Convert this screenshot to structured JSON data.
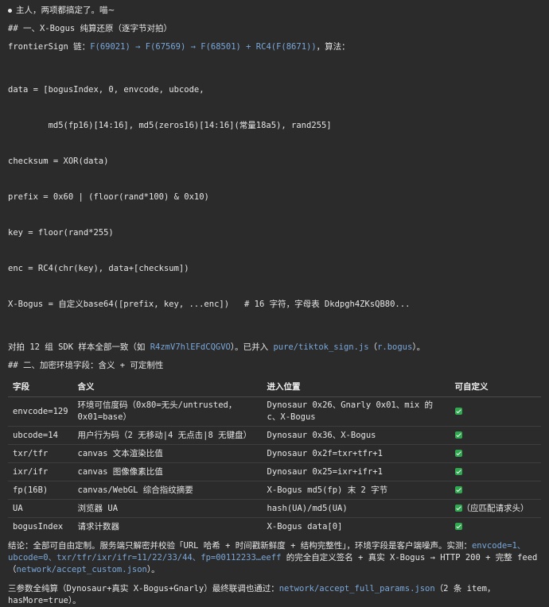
{
  "intro": "主人，两项都搞定了。喵~",
  "section1": {
    "heading": "## 一、X-Bogus 纯算还原（逐字节对拍）",
    "chain_prefix": "frontierSign 链：",
    "chain": "F(69021) → F(67569) → F(68501) + RC4(F(8671))",
    "chain_suffix": "，算法：",
    "code_lines": [
      "data = [bogusIndex, 0, envcode, ubcode,",
      "        md5(fp16)[14:16], md5(zeros16)[14:16](常量18a5), rand255]",
      "checksum = XOR(data)",
      "prefix = 0x60 | (floor(rand*100) & 0x10)",
      "key = floor(rand*255)",
      "enc = RC4(chr(key), data+[checksum])",
      "X-Bogus = 自定义base64([prefix, key, ...enc])   # 16 字符，字母表 Dkdpgh4ZKsQB80..."
    ],
    "verify_a": "对拍 12 组 SDK 样本全部一致（如 ",
    "verify_sample": "R4zmV7hlEFdCQGVO",
    "verify_b": "）。已并入 ",
    "verify_file": "pure/tiktok_sign.js",
    "verify_c": "（",
    "verify_fn": "r.bogus",
    "verify_d": "）。"
  },
  "section2": {
    "heading": "## 二、加密环境字段：含义 + 可定制性",
    "headers": [
      "字段",
      "含义",
      "进入位置",
      "可自定义"
    ],
    "rows": [
      {
        "field": "envcode=129",
        "meaning": "环境可信度码（0x80=无头/untrusted，0x01=base）",
        "position": "Dynosaur 0x26、Gnarly 0x01、mix 的 c、X-Bogus",
        "note": ""
      },
      {
        "field": "ubcode=14",
        "meaning": "用户行为码（2 无移动|4 无点击|8 无键盘）",
        "position": "Dynosaur 0x36、X-Bogus",
        "note": ""
      },
      {
        "field": "txr/tfr",
        "meaning": "canvas 文本渲染比值",
        "position": "Dynosaur 0x2f=txr+tfr+1",
        "note": ""
      },
      {
        "field": "ixr/ifr",
        "meaning": "canvas 图像像素比值",
        "position": "Dynosaur 0x25=ixr+ifr+1",
        "note": ""
      },
      {
        "field": "fp(16B)",
        "meaning": "canvas/WebGL 综合指纹摘要",
        "position": "X-Bogus md5(fp) 末 2 字节",
        "note": ""
      },
      {
        "field": "UA",
        "meaning": "浏览器 UA",
        "position": "hash(UA)/md5(UA)",
        "note": "（应匹配请求头）"
      },
      {
        "field": "bogusIndex",
        "meaning": "请求计数器",
        "position": "X-Bogus data[0]",
        "note": ""
      }
    ]
  },
  "conclusion": {
    "a": "结论：全部可自由定制。服务端只解密并校验「URL 哈希 + 时间戳新鲜度 + 结构完整性」，环境字段是客户端噪声。实测：",
    "link1": "envcode=1、ubcode=0、txr/tfr/ixr/ifr=11/22/33/44、fp=00112233…eeff",
    "b": " 的完全自定义签名 + 真实 X-Bogus → HTTP 200 + 完整 feed（",
    "link2": "network/accept_custom.json",
    "c": "）。"
  },
  "final": {
    "a": "三参数全纯算（Dynosaur+真实 X-Bogus+Gnarly）最终联调也通过：",
    "link": "network/accept_full_params.json",
    "b": "（2 条 item，hasMore=true）。"
  }
}
